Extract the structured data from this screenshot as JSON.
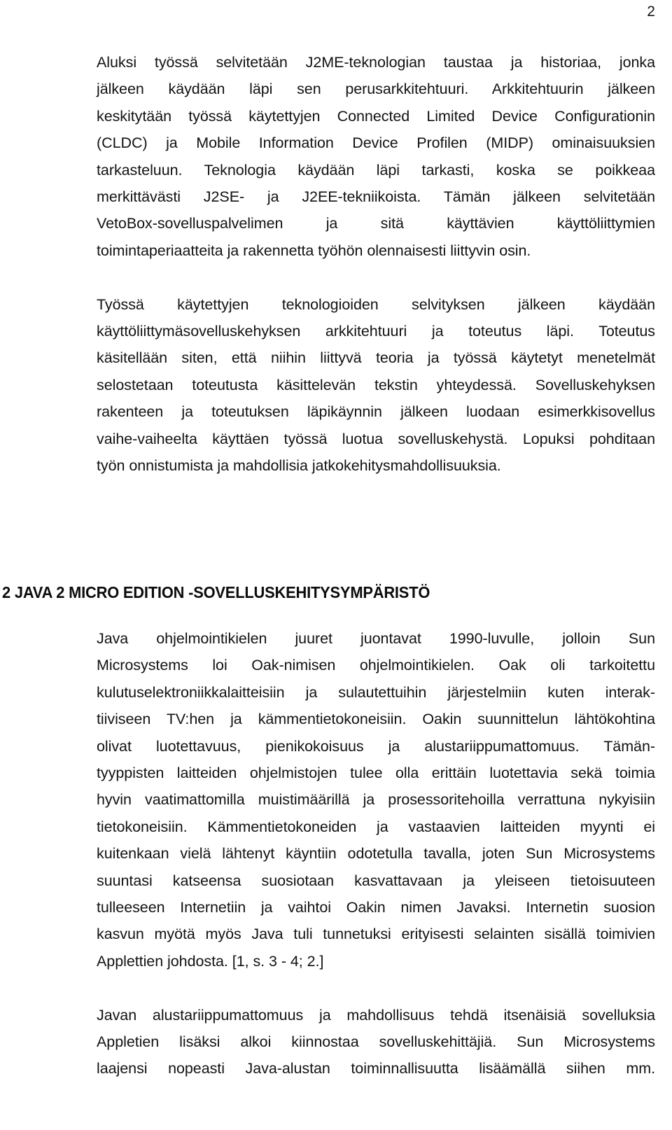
{
  "document": {
    "page_number": "2",
    "language": "fi",
    "heading": "2 JAVA 2 MICRO EDITION -SOVELLUSKEHITYSYMPÄRISTÖ"
  },
  "paragraphs": {
    "p1": {
      "lines": [
        "Aluksi työssä selvitetään J2ME-teknologian taustaa ja historiaa, jonka",
        "jälkeen käydään läpi sen perusarkkitehtuuri. Arkkitehtuurin jälkeen",
        "keskitytään työssä käytettyjen Connected Limited Device Configurationin",
        "(CLDC) ja Mobile Information Device Profilen (MIDP) ominaisuuksien",
        "tarkasteluun. Teknologia käydään läpi tarkasti, koska se poikkeaa",
        "merkittävästi J2SE- ja J2EE-tekniikoista. Tämän jälkeen selvitetään",
        "VetoBox-sovelluspalvelimen ja sitä käyttävien käyttöliittymien",
        "toimintaperiaatteita ja rakennetta työhön olennaisesti liittyvin osin."
      ]
    },
    "p2": {
      "lines": [
        "Työssä käytettyjen teknologioiden selvityksen jälkeen käydään",
        "käyttöliittymäsovelluskehyksen arkkitehtuuri ja toteutus läpi. Toteutus",
        "käsitellään siten, että niihin liittyvä teoria ja työssä käytetyt menetelmät",
        "selostetaan toteutusta käsittelevän tekstin yhteydessä. Sovelluskehyksen",
        "rakenteen ja toteutuksen läpikäynnin jälkeen luodaan esimerkkisovellus",
        "vaihe-vaiheelta käyttäen työssä luotua sovelluskehystä. Lopuksi pohditaan",
        "työn onnistumista ja mahdollisia jatkokehitysmahdollisuuksia."
      ]
    },
    "p3": {
      "lines": [
        "Java ohjelmointikielen juuret juontavat 1990-luvulle, jolloin Sun",
        "Microsystems loi Oak-nimisen ohjelmointikielen. Oak oli tarkoitettu",
        "kulutuselektroniikkalaitteisiin ja sulautettuihin järjestelmiin kuten interak-",
        "tiiviseen TV:hen ja kämmentietokoneisiin. Oakin suunnittelun lähtökohtina",
        "olivat luotettavuus, pienikokoisuus ja alustariippumattomuus. Tämän-",
        "tyyppisten laitteiden ohjelmistojen tulee olla erittäin luotettavia sekä toimia",
        "hyvin vaatimattomilla muistimäärillä ja prosessoritehoilla verrattuna nykyisiin",
        "tietokoneisiin. Kämmentietokoneiden ja vastaavien laitteiden myynti ei",
        "kuitenkaan vielä lähtenyt käyntiin odotetulla tavalla, joten Sun Microsystems",
        "suuntasi katseensa suosiotaan kasvattavaan ja yleiseen tietoisuuteen",
        "tulleeseen Internetiin ja vaihtoi Oakin nimen Javaksi. Internetin suosion",
        "kasvun myötä myös Java tuli tunnetuksi erityisesti selainten sisällä toimivien",
        "Applettien johdosta. [1, s. 3 - 4; 2.]"
      ]
    },
    "p4": {
      "lines": [
        "Javan alustariippumattomuus ja mahdollisuus tehdä itsenäisiä sovelluksia",
        "Appletien lisäksi alkoi kiinnostaa sovelluskehittäjiä. Sun Microsystems",
        "laajensi nopeasti Java-alustan toiminnallisuutta lisäämällä siihen mm."
      ]
    }
  }
}
